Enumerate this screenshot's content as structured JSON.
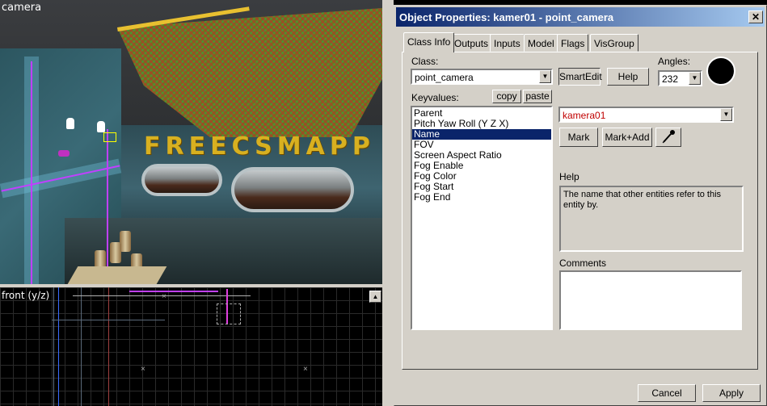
{
  "viewports": {
    "camera_label": "camera",
    "front_label": "front (y/z)",
    "banner_text": "FREECSMAPP"
  },
  "dialog": {
    "title": "Object Properties: kamer01 - point_camera",
    "close_glyph": "✕",
    "tabs": [
      "Class Info",
      "Outputs",
      "Inputs",
      "Model",
      "Flags",
      "VisGroup"
    ],
    "active_tab": 0,
    "class_label": "Class:",
    "class_value": "point_camera",
    "smartedit_label": "SmartEdit",
    "help_button_label": "Help",
    "angles_label": "Angles:",
    "angles_value": "232",
    "keyvalues_label": "Keyvalues:",
    "copy_label": "copy",
    "paste_label": "paste",
    "keyvalues": [
      "Parent",
      "Pitch Yaw Roll (Y Z X)",
      "Name",
      "FOV",
      "Screen Aspect Ratio",
      "Fog Enable",
      "Fog Color",
      "Fog Start",
      "Fog End"
    ],
    "selected_key_index": 2,
    "value_field": "kamera01",
    "mark_label": "Mark",
    "mark_add_label": "Mark+Add",
    "help_section_label": "Help",
    "help_text": "The name that other entities refer to this entity by.",
    "comments_label": "Comments",
    "comments_value": "",
    "cancel_label": "Cancel",
    "apply_label": "Apply"
  },
  "colors": {
    "titlebar_start": "#0a246a",
    "titlebar_end": "#a6caf0",
    "selection": "#0a246a",
    "value_text": "#c00000"
  }
}
